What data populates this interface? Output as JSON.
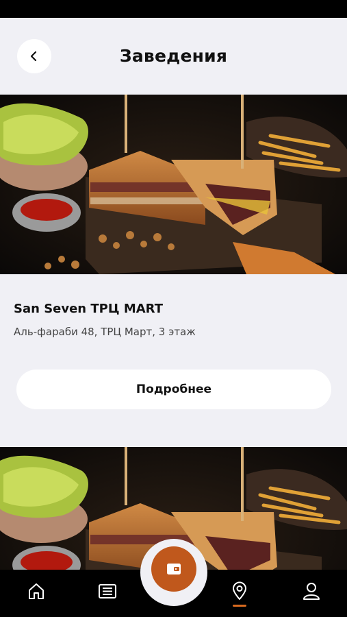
{
  "header": {
    "title": "Заведения",
    "back_icon": "chevron-left-icon"
  },
  "venue": {
    "name": "San Seven ТРЦ MART",
    "address": "Аль-фараби 48, ТРЦ Март, 3 этаж",
    "details_label": "Подробнее"
  },
  "bottom_nav": {
    "items": [
      {
        "icon": "home-icon"
      },
      {
        "icon": "news-icon"
      },
      {
        "icon": "location-pin-icon",
        "active": true
      },
      {
        "icon": "profile-icon"
      }
    ],
    "center_button_icon": "wallet-icon"
  },
  "colors": {
    "background": "#f0f0f5",
    "accent": "#c0581c",
    "active_indicator": "#d86a1f",
    "nav_background": "#000000"
  }
}
